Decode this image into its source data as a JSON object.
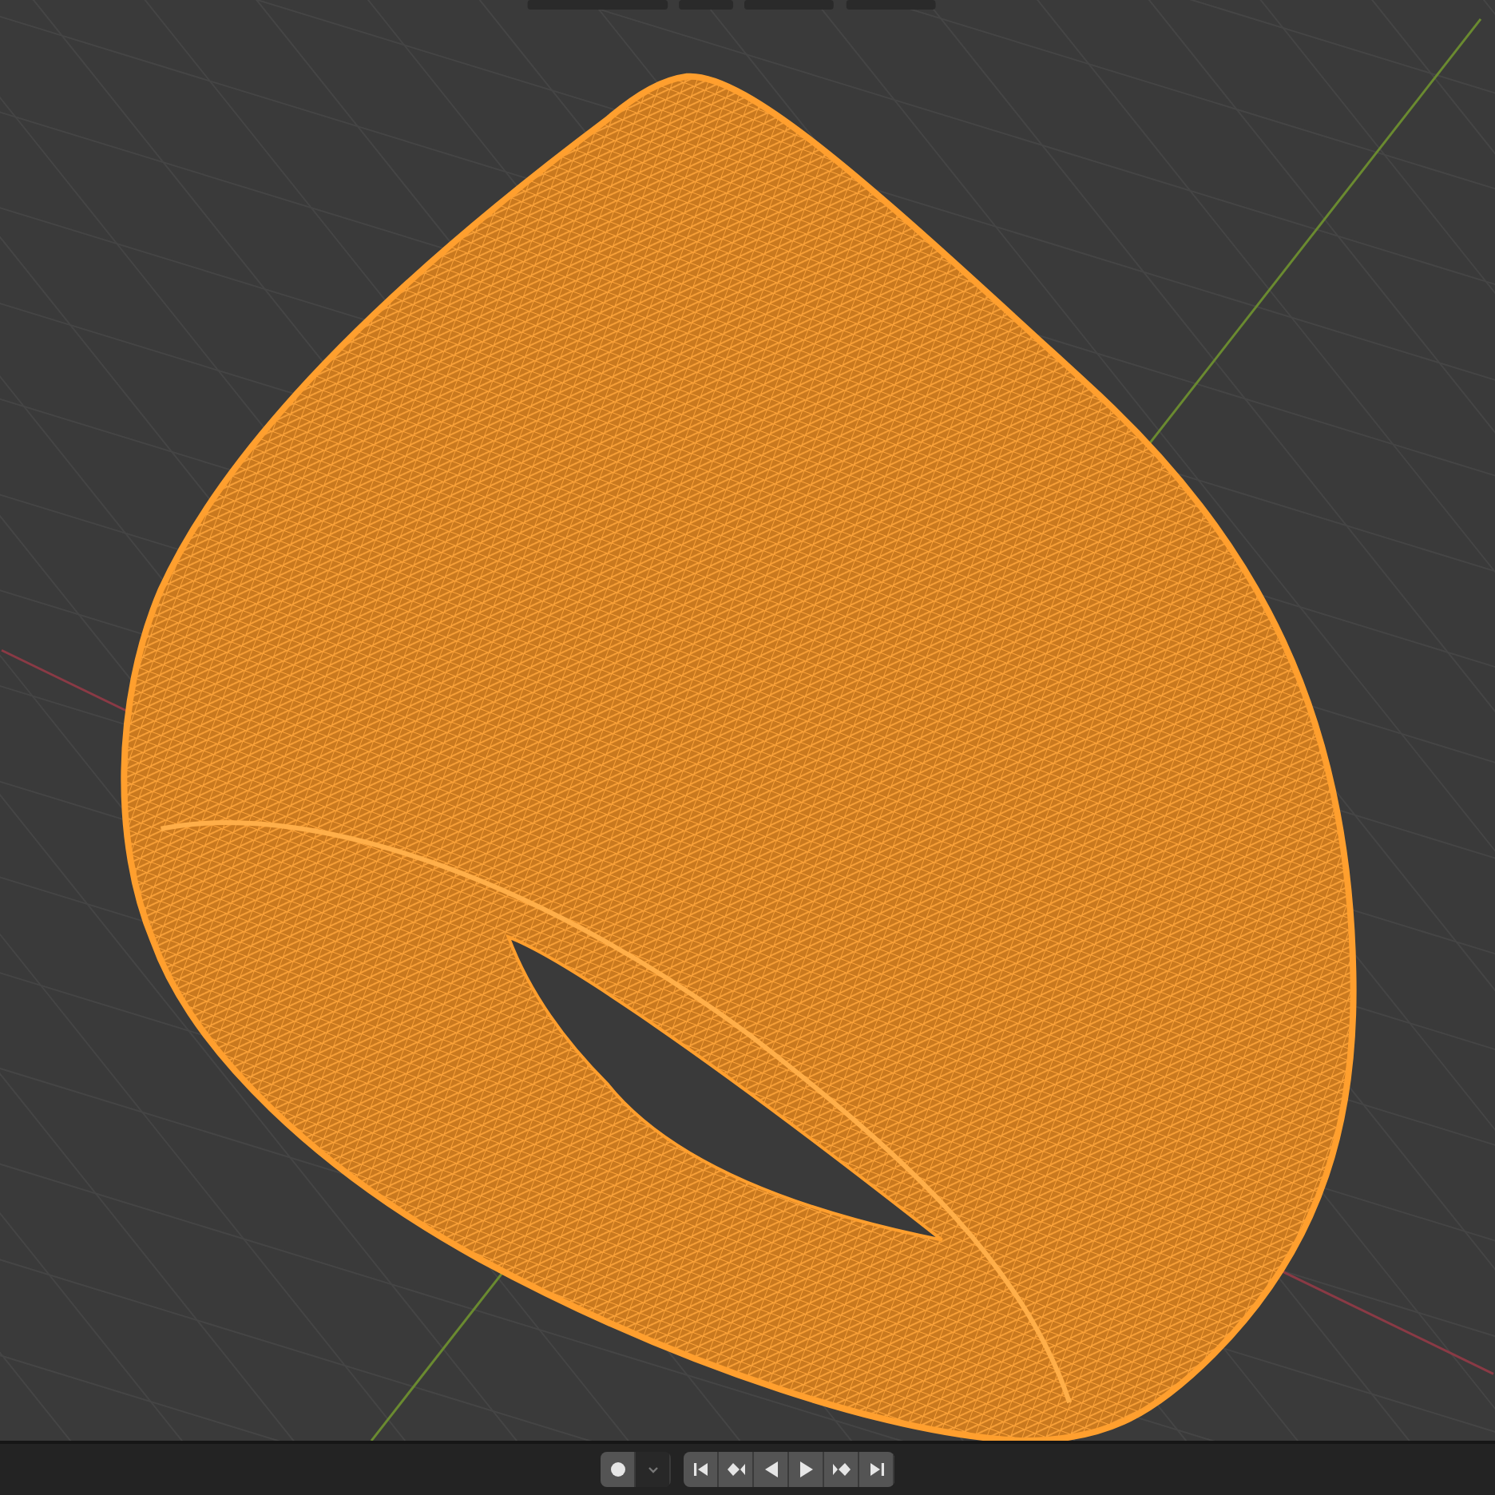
{
  "timeline_controls": [
    {
      "kind": "record",
      "on": false
    },
    {
      "kind": "record_menu",
      "on": false
    },
    {
      "kind": "jump_start",
      "on": false
    },
    {
      "kind": "prev_key",
      "on": false
    },
    {
      "kind": "play_reverse",
      "on": false
    },
    {
      "kind": "play",
      "on": false
    },
    {
      "kind": "next_key",
      "on": false
    },
    {
      "kind": "jump_end",
      "on": false
    }
  ]
}
